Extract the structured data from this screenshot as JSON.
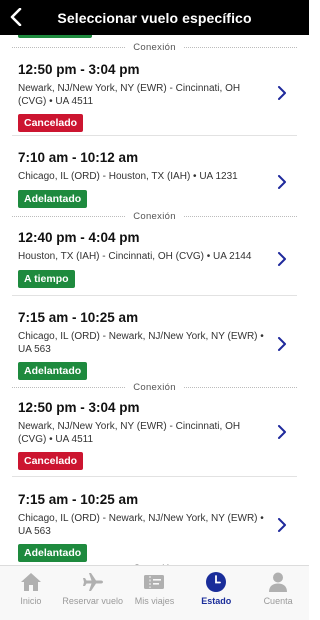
{
  "header": {
    "title": "Seleccionar vuelo específico"
  },
  "colors": {
    "cancelado": "#cc1530",
    "green": "#1e8a3e",
    "chevron": "#1f2a9c",
    "active_tab": "#1a2d9a"
  },
  "list": {
    "connection_label": "Conexión",
    "flights": [
      {
        "time": "12:50 pm - 3:04 pm",
        "route": "Newark, NJ/New York, NY (EWR) - Cincinnati, OH (CVG) • UA 4511",
        "status": "Cancelado",
        "status_color": "#cc1530"
      },
      {
        "time": "7:10 am - 10:12 am",
        "route": "Chicago, IL (ORD) - Houston, TX (IAH) • UA 1231",
        "status": "Adelantado",
        "status_color": "#1e8a3e"
      },
      {
        "time": "12:40 pm - 4:04 pm",
        "route": "Houston, TX (IAH) - Cincinnati, OH (CVG) • UA 2144",
        "status": "A tiempo",
        "status_color": "#1e8a3e"
      },
      {
        "time": "7:15 am - 10:25 am",
        "route": "Chicago, IL (ORD) - Newark, NJ/New York, NY (EWR) • UA 563",
        "status": "Adelantado",
        "status_color": "#1e8a3e"
      },
      {
        "time": "12:50 pm - 3:04 pm",
        "route": "Newark, NJ/New York, NY (EWR) - Cincinnati, OH (CVG) • UA 4511",
        "status": "Cancelado",
        "status_color": "#cc1530"
      },
      {
        "time": "7:15 am - 10:25 am",
        "route": "Chicago, IL (ORD) - Newark, NJ/New York, NY (EWR) • UA 563",
        "status": "Adelantado",
        "status_color": "#1e8a3e"
      }
    ]
  },
  "tabbar": {
    "tabs": [
      {
        "label": "Inicio",
        "icon": "home-icon"
      },
      {
        "label": "Reservar vuelo",
        "icon": "airplane-icon"
      },
      {
        "label": "Mis viajes",
        "icon": "ticket-icon"
      },
      {
        "label": "Estado",
        "icon": "clock-icon",
        "active": true
      },
      {
        "label": "Cuenta",
        "icon": "person-icon"
      }
    ]
  }
}
